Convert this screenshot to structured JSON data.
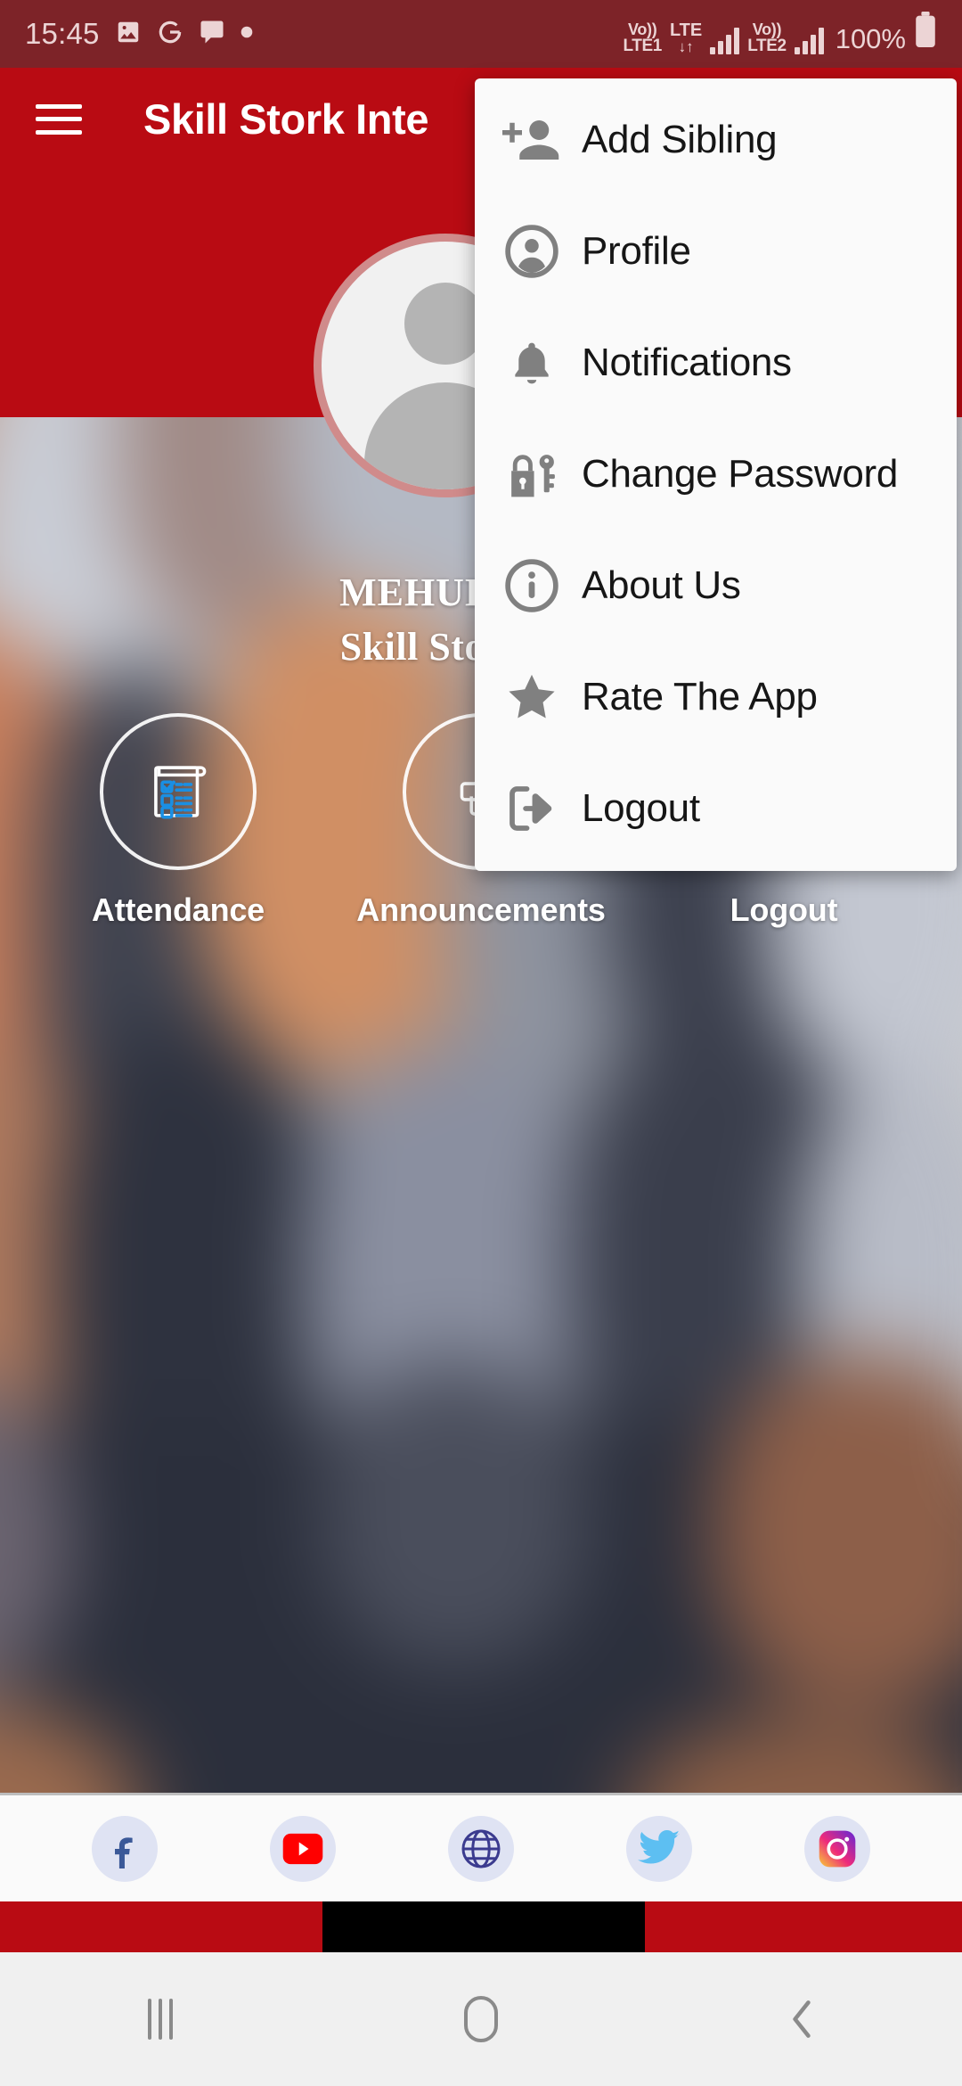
{
  "status_bar": {
    "time": "15:45",
    "icons": [
      "image-icon",
      "google-icon",
      "message-icon",
      "dot-icon"
    ],
    "sim1_volte": "Vo))",
    "sim1_lte": "LTE1",
    "lte_label": "LTE",
    "sim2_volte": "Vo))",
    "sim2_lte": "LTE2",
    "battery_percent": "100%"
  },
  "app_bar": {
    "menu_icon": "hamburger-icon",
    "title": "Skill Stork Inte"
  },
  "profile": {
    "avatar_icon": "user-avatar-icon",
    "name": "MEHUL  JOSHI",
    "school": "Skill Stork Inter"
  },
  "actions": [
    {
      "label": "Attendance",
      "icon": "checklist-icon"
    },
    {
      "label": "Announcements",
      "icon": "megaphone-icon"
    },
    {
      "label": "Logout",
      "icon": "logout-icon"
    }
  ],
  "menu": {
    "items": [
      {
        "label": "Add Sibling",
        "icon": "person-add-icon"
      },
      {
        "label": "Profile",
        "icon": "account-circle-icon"
      },
      {
        "label": "Notifications",
        "icon": "bell-icon"
      },
      {
        "label": "Change Password",
        "icon": "lock-key-icon"
      },
      {
        "label": "About Us",
        "icon": "info-circle-icon"
      },
      {
        "label": "Rate The App",
        "icon": "star-icon"
      },
      {
        "label": "Logout",
        "icon": "logout-arrow-icon"
      }
    ]
  },
  "social": [
    {
      "name": "Facebook",
      "icon": "facebook-icon",
      "color": "#3b5998"
    },
    {
      "name": "YouTube",
      "icon": "youtube-icon",
      "color": "#ff0000"
    },
    {
      "name": "Website",
      "icon": "globe-icon",
      "color": "#3b3b8f"
    },
    {
      "name": "Twitter",
      "icon": "twitter-icon",
      "color": "#5dbff2"
    },
    {
      "name": "Instagram",
      "icon": "instagram-icon",
      "color": "#e1306c"
    }
  ],
  "nav_bar": {
    "recents": "recents-icon",
    "home": "home-icon",
    "back": "back-icon"
  },
  "colors": {
    "status_bar": "#7d2328",
    "app_bar": "#b90b13",
    "menu_bg": "#fafafa",
    "accent_blue": "#1a8fe3"
  }
}
